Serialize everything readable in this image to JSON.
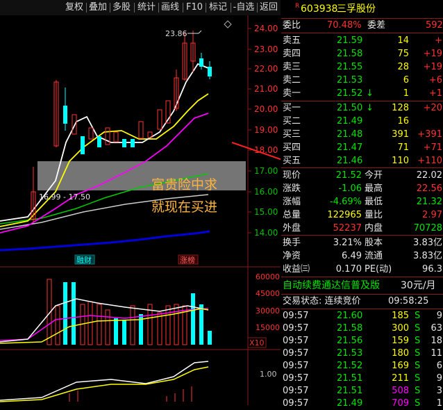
{
  "toolbar": {
    "buttons": [
      "复权",
      "叠加",
      "多股",
      "统计",
      "画线",
      "F10",
      "标记",
      "-自选",
      "返回"
    ]
  },
  "chart": {
    "price_axis": [
      "24.00",
      "23.00",
      "22.00",
      "21.00",
      "20.00",
      "19.00",
      "18.00",
      "17.00",
      "16.00",
      "15.00",
      "14.00"
    ],
    "high_label": "23.86",
    "range_label": "16.99 - 17.50",
    "ad_line1": "富贵险中求",
    "ad_line2": "就现在买进",
    "badge_left": "融财",
    "badge_right": "涨榜",
    "volume_axis": [
      "60000",
      "45000",
      "30000",
      "15000"
    ],
    "volume_unit": "X10",
    "macd_axis": "1.00"
  },
  "stock": {
    "r_flag": "R",
    "code": "603938",
    "name": "三孚股份"
  },
  "commission": {
    "ratio_label": "委比",
    "ratio_value": "70.48%",
    "diff_label": "委差",
    "diff_value": "592"
  },
  "asks": [
    {
      "label": "卖五",
      "price": "21.59",
      "vol": "14",
      "chg": "+"
    },
    {
      "label": "卖四",
      "price": "21.58",
      "vol": "75",
      "chg": "+19"
    },
    {
      "label": "卖三",
      "price": "21.55",
      "vol": "28",
      "chg": "+19"
    },
    {
      "label": "卖二",
      "price": "21.53",
      "vol": "6",
      "chg": "+6"
    },
    {
      "label": "卖一",
      "price": "21.52",
      "vol": "1",
      "chg": "+1",
      "arrow": "↓"
    }
  ],
  "bids": [
    {
      "label": "买一",
      "price": "21.50",
      "vol": "128",
      "chg": "+20",
      "arrow": "↓"
    },
    {
      "label": "买二",
      "price": "21.49",
      "vol": "16",
      "chg": ""
    },
    {
      "label": "买三",
      "price": "21.48",
      "vol": "391",
      "chg": "+391"
    },
    {
      "label": "买四",
      "price": "21.47",
      "vol": "71",
      "chg": "+71"
    },
    {
      "label": "买五",
      "price": "21.46",
      "vol": "110",
      "chg": "+110"
    }
  ],
  "quote": [
    {
      "l1": "现价",
      "v1": "21.52",
      "l2": "今开",
      "v2": "22.02"
    },
    {
      "l1": "涨跌",
      "v1": "-1.06",
      "l2": "最高",
      "v2": "22.56"
    },
    {
      "l1": "涨幅",
      "v1": "-4.69%",
      "l2": "最低",
      "v2": "21.32"
    },
    {
      "l1": "总量",
      "v1": "122965",
      "l2": "量比",
      "v2": "2.97"
    },
    {
      "l1": "外盘",
      "v1": "52237",
      "l2": "内盘",
      "v2": "70728"
    }
  ],
  "fundamentals": [
    {
      "l1": "换手",
      "v1": "3.21%",
      "l2": "股本",
      "v2": "3.83亿"
    },
    {
      "l1": "净资",
      "v1": "6.49",
      "l2": "流通",
      "v2": "3.83亿"
    },
    {
      "l1": "收益㈢",
      "v1": "0.170",
      "l2": "PE(动)",
      "v2": "96.3"
    }
  ],
  "promo": {
    "text": "自动续费通达信普及版",
    "price": "30元/月"
  },
  "trade_status": {
    "label": "交易状态: 连续竞价",
    "time": "09:58:25"
  },
  "ticks": [
    {
      "time": "09:57",
      "price": "21.60",
      "vol": "185",
      "side": "S",
      "n": "9"
    },
    {
      "time": "09:57",
      "price": "21.58",
      "vol": "300",
      "side": "S",
      "n": "63"
    },
    {
      "time": "09:57",
      "price": "21.56",
      "vol": "159",
      "side": "S",
      "n": "18"
    },
    {
      "time": "09:57",
      "price": "21.53",
      "vol": "180",
      "side": "S",
      "n": "11"
    },
    {
      "time": "09:57",
      "price": "21.52",
      "vol": "169",
      "side": "S",
      "n": "6"
    },
    {
      "time": "09:57",
      "price": "21.51",
      "vol": "211",
      "side": "S",
      "n": "9"
    },
    {
      "time": "09:57",
      "price": "21.51",
      "vol": "508",
      "side": "S",
      "n": "3"
    },
    {
      "time": "09:57",
      "price": "21.49",
      "vol": "709",
      "side": "S",
      "n": "1"
    }
  ],
  "colors": {
    "up": "#ff3232",
    "down": "#00e600",
    "neutral": "#e6e6e6",
    "accent": "#ffff00",
    "panel_line": "#8b1a1a"
  }
}
